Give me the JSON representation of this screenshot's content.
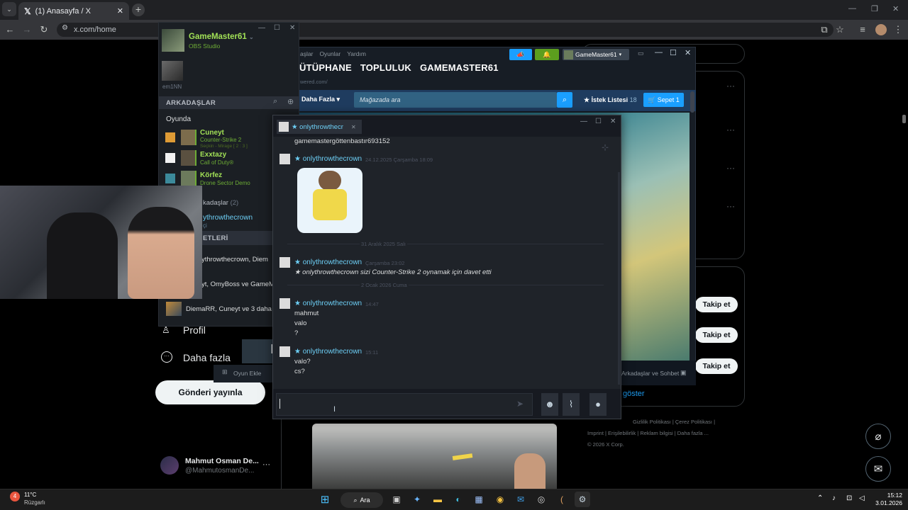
{
  "browser": {
    "tab_title": "(1) Anasayfa / X",
    "url": "x.com/home",
    "new_tab": "+"
  },
  "x": {
    "nav_profile": "Profil",
    "nav_more": "Daha fazla",
    "post_button": "Gönderi yayınla",
    "user_name": "Mahmut Osman De...",
    "user_handle": "@MahmutosmanDe...",
    "follow_label": "Takip et",
    "show_more": "göster",
    "footer_links": [
      "Gizlilik Politikası",
      "Çerez Politikası",
      "Imprint",
      "Erişilebilirlik",
      "Reklam bilgisi",
      "Daha fazla ..."
    ],
    "copyright": "© 2026 X Corp."
  },
  "friends": {
    "username": "GameMaster61",
    "status": "OBS Studio",
    "small_user": "em1NN",
    "header": "ARKADAŞLAR",
    "ingame_label": "Oyunda",
    "entries": [
      {
        "name": "Cuneyt",
        "game": "Counter-Strike 2",
        "detail": "Seçkin - Mirage [ 2 : 3 ]"
      },
      {
        "name": "Exxtazy",
        "game": "Call of Duty®",
        "detail": ""
      },
      {
        "name": "Körfez",
        "game": "Drone Sector Demo",
        "detail": ""
      }
    ],
    "friends_section": "kadaşlar",
    "friends_count": "(2)",
    "friend_online": "ythrowthecrown",
    "friend_sub": "çi",
    "groups_header": "ETLERİ",
    "groups": [
      "ythrowthecrown, Diem",
      "yt, OmyBoss ve GameM",
      "DiemaRR, Cuneyt ve 3 daha"
    ],
    "add_game": "Oyun Ekle"
  },
  "steam": {
    "menu": [
      "aşlar",
      "Oyunlar",
      "Yardım"
    ],
    "nav": [
      "ÜTÜPHANE",
      "TOPLULUK",
      "GAMEMASTER61"
    ],
    "url_hint": "wered.com/",
    "account": "GameMaster61",
    "more": "Daha Fazla",
    "search_placeholder": "Mağazada ara",
    "wishlist": "İstek Listesi",
    "wishlist_count": "18",
    "cart": "Sepet",
    "cart_count": "1",
    "friends_chat": "Arkadaşlar ve Sohbet"
  },
  "chat": {
    "tab_title": "★ onlythrowthecr",
    "first_line": "gamemastergöttenbastır693152",
    "messages": [
      {
        "author": "★ onlythrowthecrown",
        "time": "24.12.2025 Çarşamba 18:09",
        "lines": []
      },
      {
        "author": "★ onlythrowthecrown",
        "time": "Çarşamba 23:02",
        "lines": [
          "★ onlythrowthecrown sizi  Counter-Strike 2 oynamak için davet etti"
        ]
      },
      {
        "author": "★ onlythrowthecrown",
        "time": "14:47",
        "lines": [
          "mahmut",
          "valo",
          "?"
        ]
      },
      {
        "author": "★ onlythrowthecrown",
        "time": "15:11",
        "lines": [
          "valo?",
          "cs?"
        ]
      }
    ],
    "dividers": [
      "31 Aralık 2025 Salı",
      "2 Ocak 2026 Cuma"
    ]
  },
  "taskbar": {
    "temp": "11°C",
    "weather": "Rüzgarlı",
    "search": "Ara",
    "time": "15:12",
    "date": "3.01.2026"
  }
}
